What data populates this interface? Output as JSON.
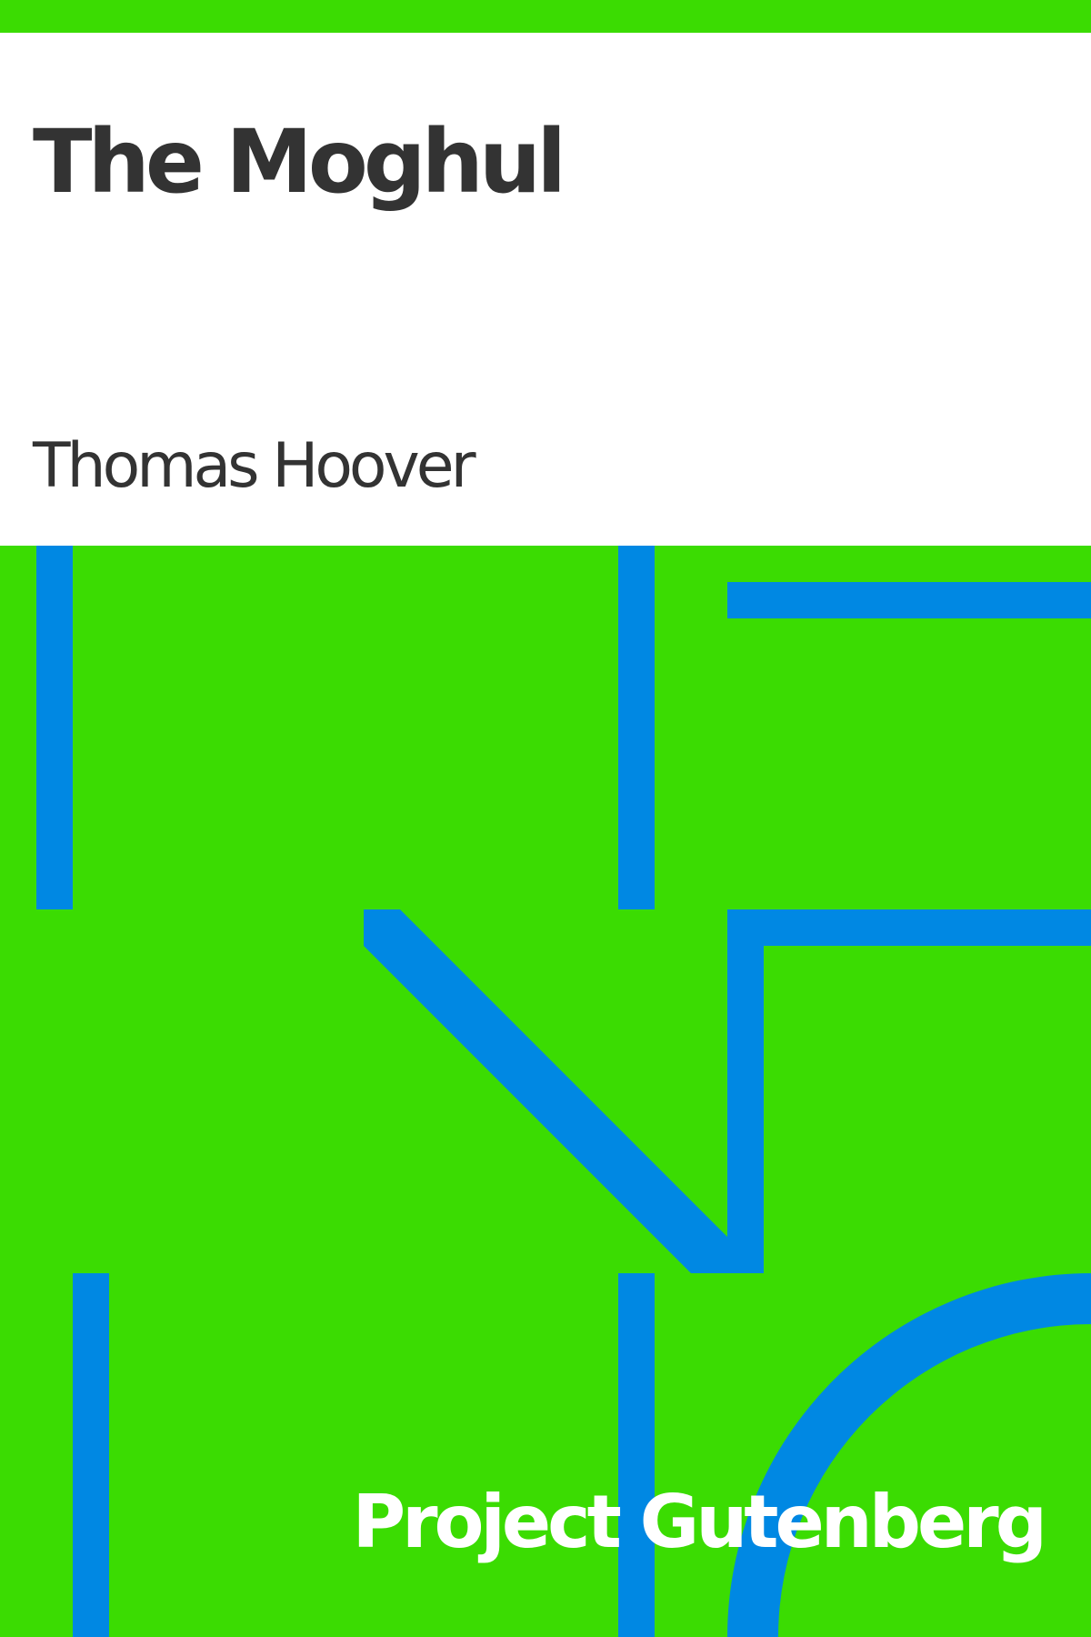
{
  "cover": {
    "title": "The Moghul",
    "author": "Thomas Hoover",
    "publisher": "Project Gutenberg"
  },
  "colors": {
    "background": "#3bdc02",
    "panel": "#ffffff",
    "text_dark": "#333333",
    "shapes": "#0088e3",
    "text_light": "#ffffff"
  }
}
